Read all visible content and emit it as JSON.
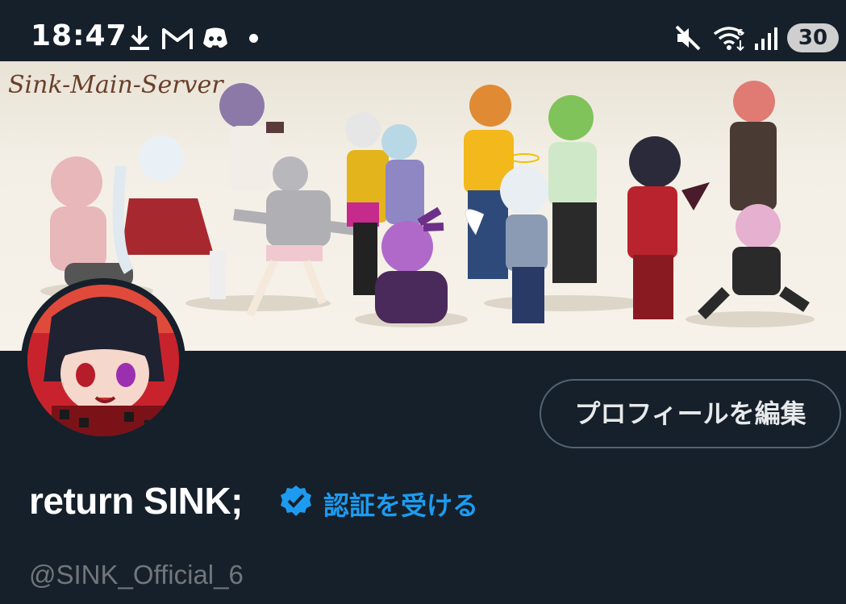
{
  "status_bar": {
    "time": "18:47",
    "icons": [
      "download-icon",
      "gmail-icon",
      "discord-icon",
      "notification-dot",
      "mute-icon",
      "wifi-icon",
      "signal-icon"
    ],
    "battery": "30"
  },
  "banner": {
    "title": "Sink-Main-Server"
  },
  "profile": {
    "edit_button": "プロフィールを編集",
    "display_name": "return SINK;",
    "get_verified": "認証を受ける",
    "handle": "@SINK_Official_6"
  },
  "colors": {
    "background": "#15202b",
    "accent": "#1d9bf0",
    "muted": "#71767b",
    "border": "#536471"
  }
}
